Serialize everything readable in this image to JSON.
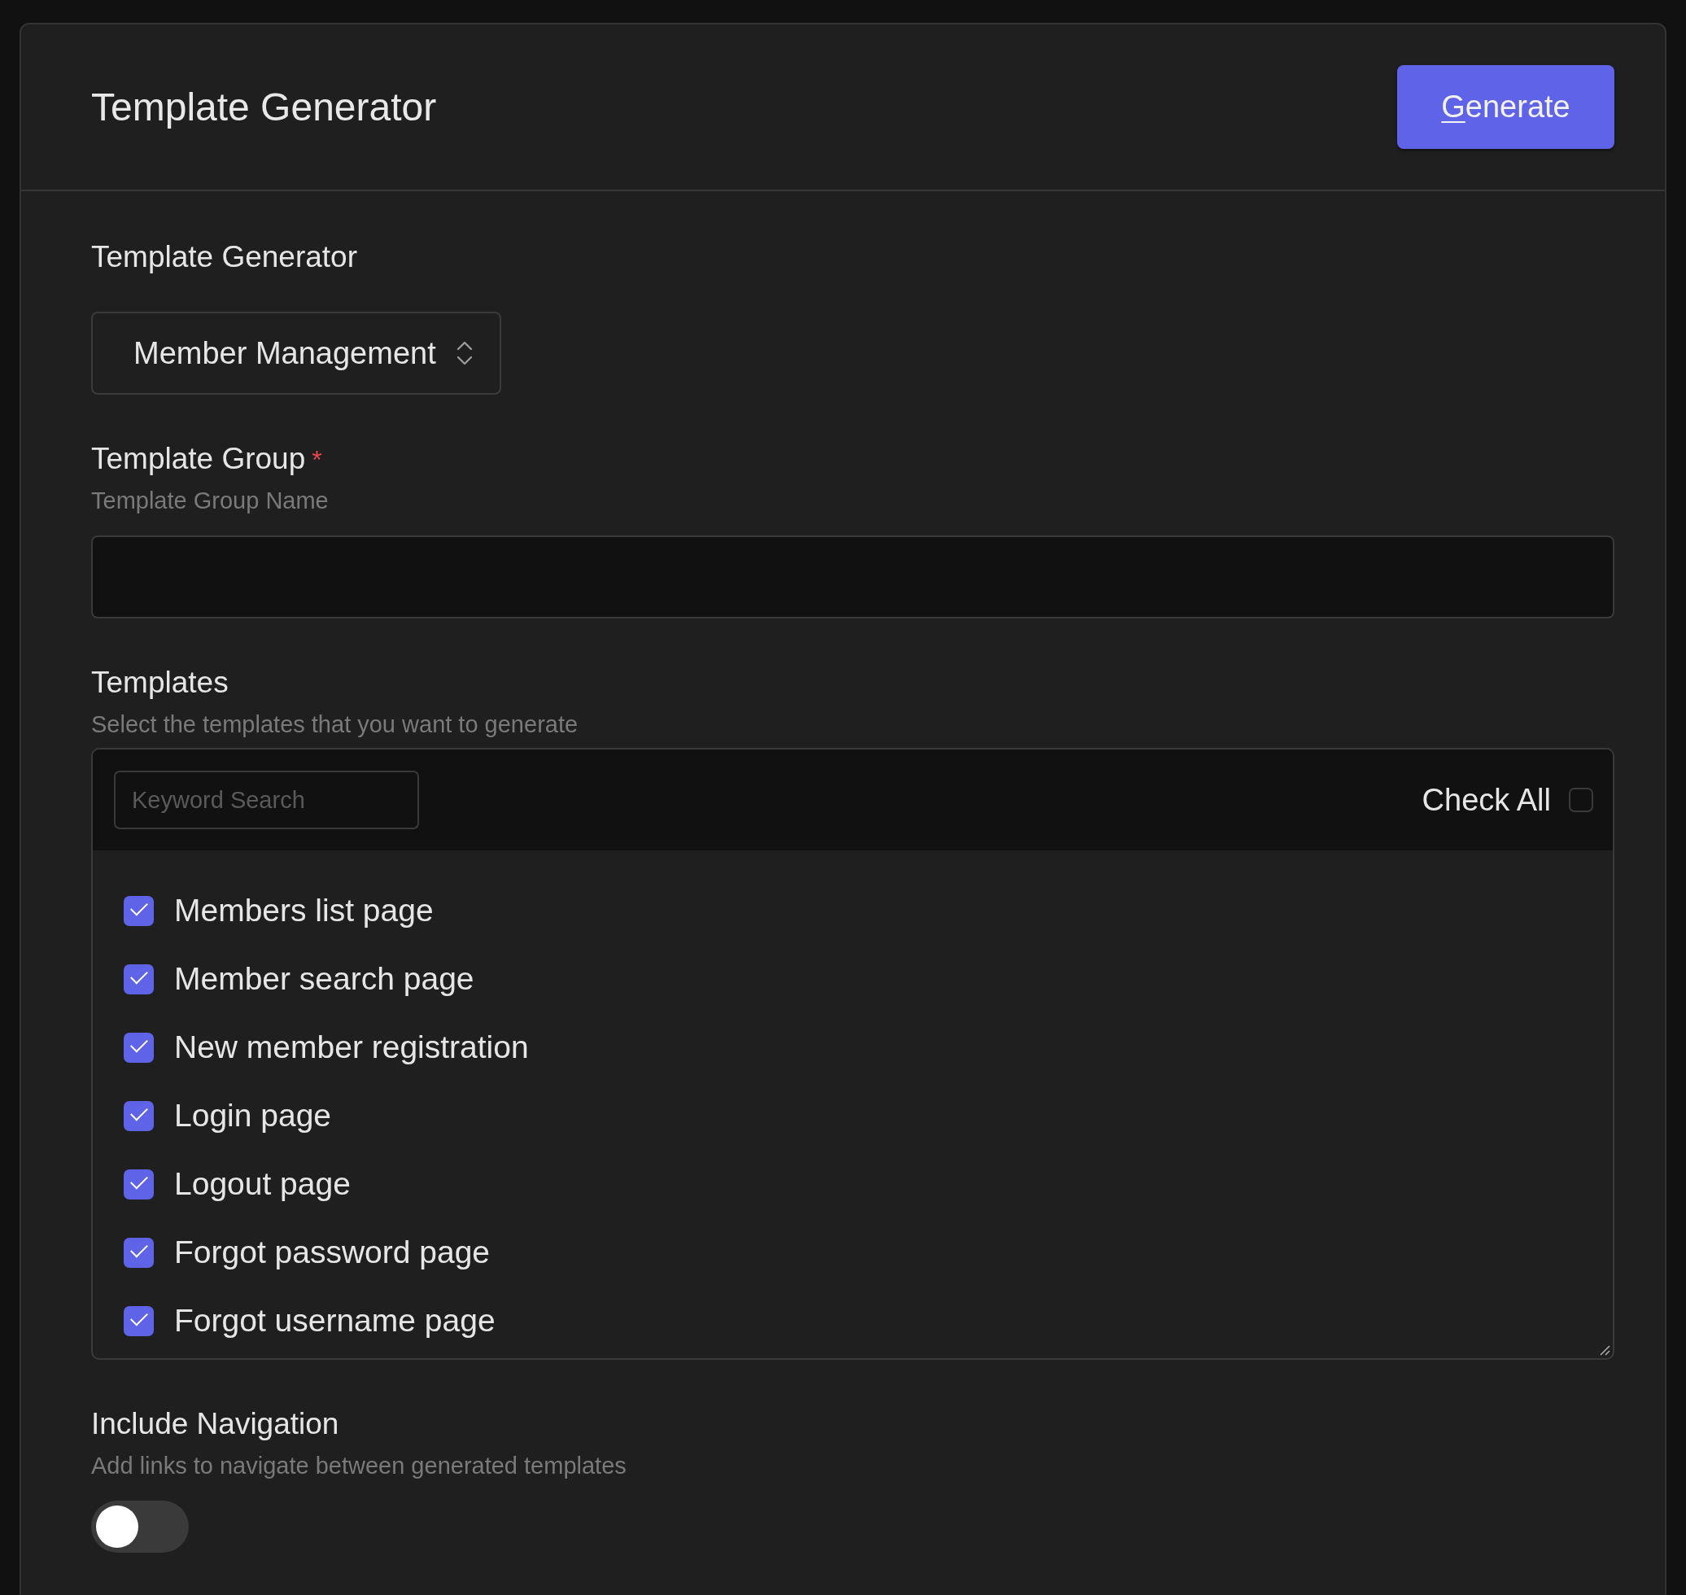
{
  "header": {
    "title": "Template Generator",
    "button": {
      "label": "Generate",
      "first_letter_underlined": true
    }
  },
  "generator": {
    "label": "Template Generator",
    "value": "Member Management"
  },
  "group": {
    "label": "Template Group",
    "required_mark": "*",
    "hint": "Template Group Name"
  },
  "templates": {
    "label": "Templates",
    "hint": "Select the templates that you want to generate",
    "search_placeholder": "Keyword Search",
    "check_all": {
      "label": "Check All",
      "checked": false
    },
    "items": [
      {
        "label": "Members list page",
        "checked": true
      },
      {
        "label": "Member search page",
        "checked": true
      },
      {
        "label": "New member registration",
        "checked": true
      },
      {
        "label": "Login page",
        "checked": true
      },
      {
        "label": "Logout page",
        "checked": true
      },
      {
        "label": "Forgot password page",
        "checked": true
      },
      {
        "label": "Forgot username page",
        "checked": true
      }
    ]
  },
  "navigation": {
    "label": "Include Navigation",
    "hint": "Add links to navigate between generated templates",
    "on": false
  }
}
